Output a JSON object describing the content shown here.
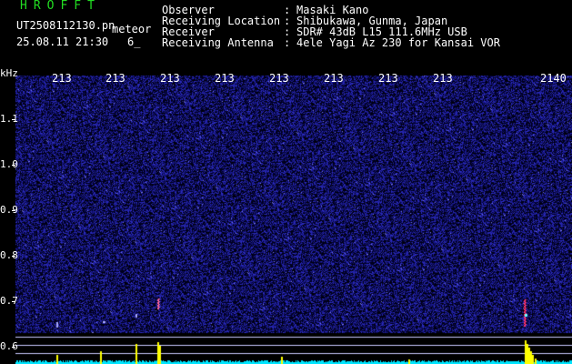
{
  "header": {
    "title": "HROFFT",
    "filename": "UT2508112130.pn",
    "mode": "meteor",
    "datetime": "25.08.11 21:30",
    "count": "6_"
  },
  "meta": [
    {
      "label": "Observer",
      "value": "Masaki Kano"
    },
    {
      "label": "Receiving Location",
      "value": "Shibukawa, Gunma, Japan"
    },
    {
      "label": "Receiver",
      "value": "SDR# 43dB L15 111.6MHz USB"
    },
    {
      "label": "Receiving Antenna",
      "value": "4ele Yagi Az 230 for Kansai VOR"
    }
  ],
  "axis": {
    "unit": "kHz",
    "y_labels": [
      "1.1",
      "1.0",
      "0.9",
      "0.8",
      "0.7",
      "0.6"
    ],
    "time_labels": [
      "213",
      "213",
      "213",
      "213",
      "213",
      "213",
      "213",
      "213",
      "2140"
    ]
  },
  "colors": {
    "background": "#000000",
    "noise": "#1a1a8a",
    "signal": "#ffff00",
    "baseline": "#00e5ff",
    "grid_line": "#c8c8ff",
    "title": "#22dd22"
  }
}
